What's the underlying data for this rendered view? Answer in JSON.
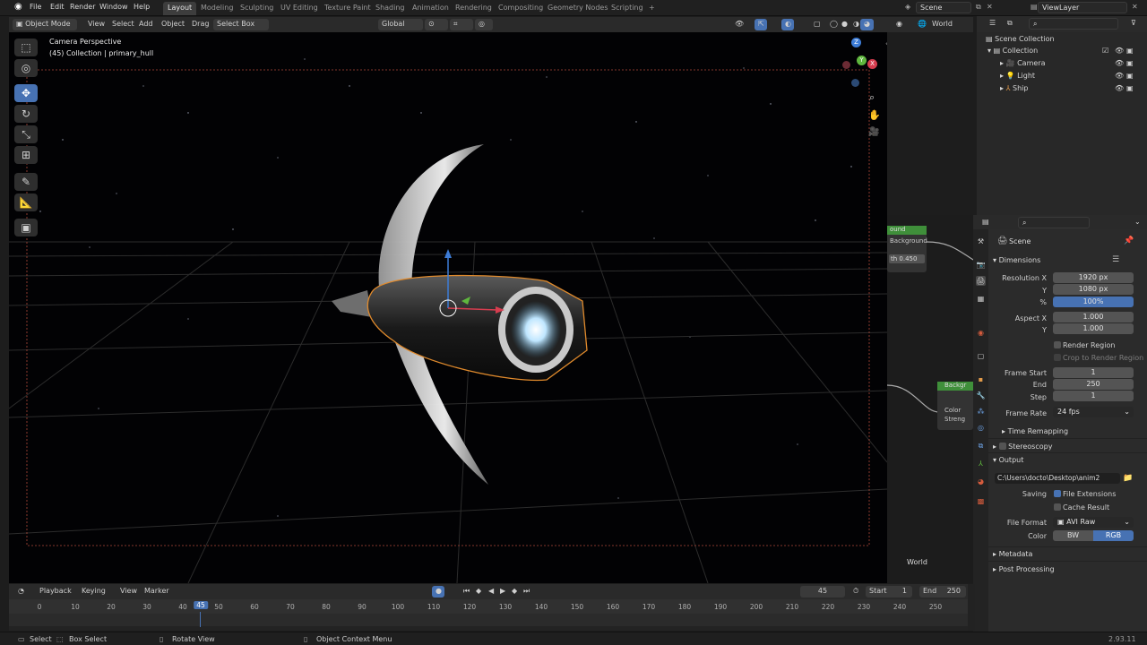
{
  "topbar": {
    "menus": [
      "File",
      "Edit",
      "Render",
      "Window",
      "Help"
    ],
    "workspaces": [
      "Layout",
      "Modeling",
      "Sculpting",
      "UV Editing",
      "Texture Paint",
      "Shading",
      "Animation",
      "Rendering",
      "Compositing",
      "Geometry Nodes",
      "Scripting"
    ],
    "active_workspace": "Layout",
    "add_tab": "+",
    "scene": "Scene",
    "view_layer": "ViewLayer"
  },
  "viewport_header": {
    "mode": "Object Mode",
    "view": "View",
    "select": "Select",
    "add": "Add",
    "object": "Object",
    "drag_label": "Drag",
    "drag_value": "Select Box",
    "orientation": "Global"
  },
  "viewport": {
    "camera_label": "Camera Perspective",
    "collection_label": "(45) Collection | primary_hull",
    "gizmo": {
      "z": "Z",
      "y": "Y",
      "x": "X"
    }
  },
  "outliner": {
    "display_mode": "World",
    "rows": [
      {
        "label": "Scene Collection"
      },
      {
        "label": "Collection"
      },
      {
        "label": "Camera"
      },
      {
        "label": "Light"
      },
      {
        "label": "Ship"
      }
    ]
  },
  "node_editor": {
    "node1_title": "ound",
    "node1_socket": "Background",
    "node1_field": "th  0.450",
    "node2_title": "Backgr",
    "node2_color": "Color",
    "node2_strength": "Streng",
    "world_label": "World"
  },
  "properties": {
    "context": "Scene",
    "dimensions": {
      "title": "Dimensions",
      "resolution_x_label": "Resolution X",
      "resolution_x": "1920 px",
      "y_label": "Y",
      "resolution_y": "1080 px",
      "percent_label": "%",
      "percent": "100%",
      "aspect_x_label": "Aspect X",
      "aspect_x": "1.000",
      "aspect_y_label": "Y",
      "aspect_y": "1.000",
      "render_region": "Render Region",
      "crop_region": "Crop to Render Region",
      "frame_start_label": "Frame Start",
      "frame_start": "1",
      "end_label": "End",
      "frame_end": "250",
      "step_label": "Step",
      "frame_step": "1",
      "frame_rate_label": "Frame Rate",
      "frame_rate": "24 fps",
      "time_remapping": "Time Remapping"
    },
    "stereoscopy": "Stereoscopy",
    "output": {
      "title": "Output",
      "path": "C:\\Users\\docto\\Desktop\\anim2",
      "saving_label": "Saving",
      "file_extensions": "File Extensions",
      "cache_result": "Cache Result",
      "file_format_label": "File Format",
      "file_format": "AVI Raw",
      "color_label": "Color",
      "color_bw": "BW",
      "color_rgb": "RGB"
    },
    "metadata": "Metadata",
    "post_processing": "Post Processing"
  },
  "timeline": {
    "playback": "Playback",
    "keying": "Keying",
    "view": "View",
    "marker": "Marker",
    "current_frame": "45",
    "start_label": "Start",
    "start": "1",
    "end_label": "End",
    "end": "250",
    "ticks": [
      "0",
      "10",
      "20",
      "30",
      "40",
      "45",
      "50",
      "60",
      "70",
      "80",
      "90",
      "100",
      "110",
      "120",
      "130",
      "140",
      "150",
      "160",
      "170",
      "180",
      "190",
      "200",
      "210",
      "220",
      "230",
      "240",
      "250"
    ]
  },
  "statusbar": {
    "select": "Select",
    "box_select": "Box Select",
    "rotate_view": "Rotate View",
    "context_menu": "Object Context Menu",
    "version": "2.93.11"
  },
  "colors": {
    "accent": "#4772b3",
    "selection_outline": "#e08a2c",
    "node_header_green": "#3f8f3a"
  }
}
